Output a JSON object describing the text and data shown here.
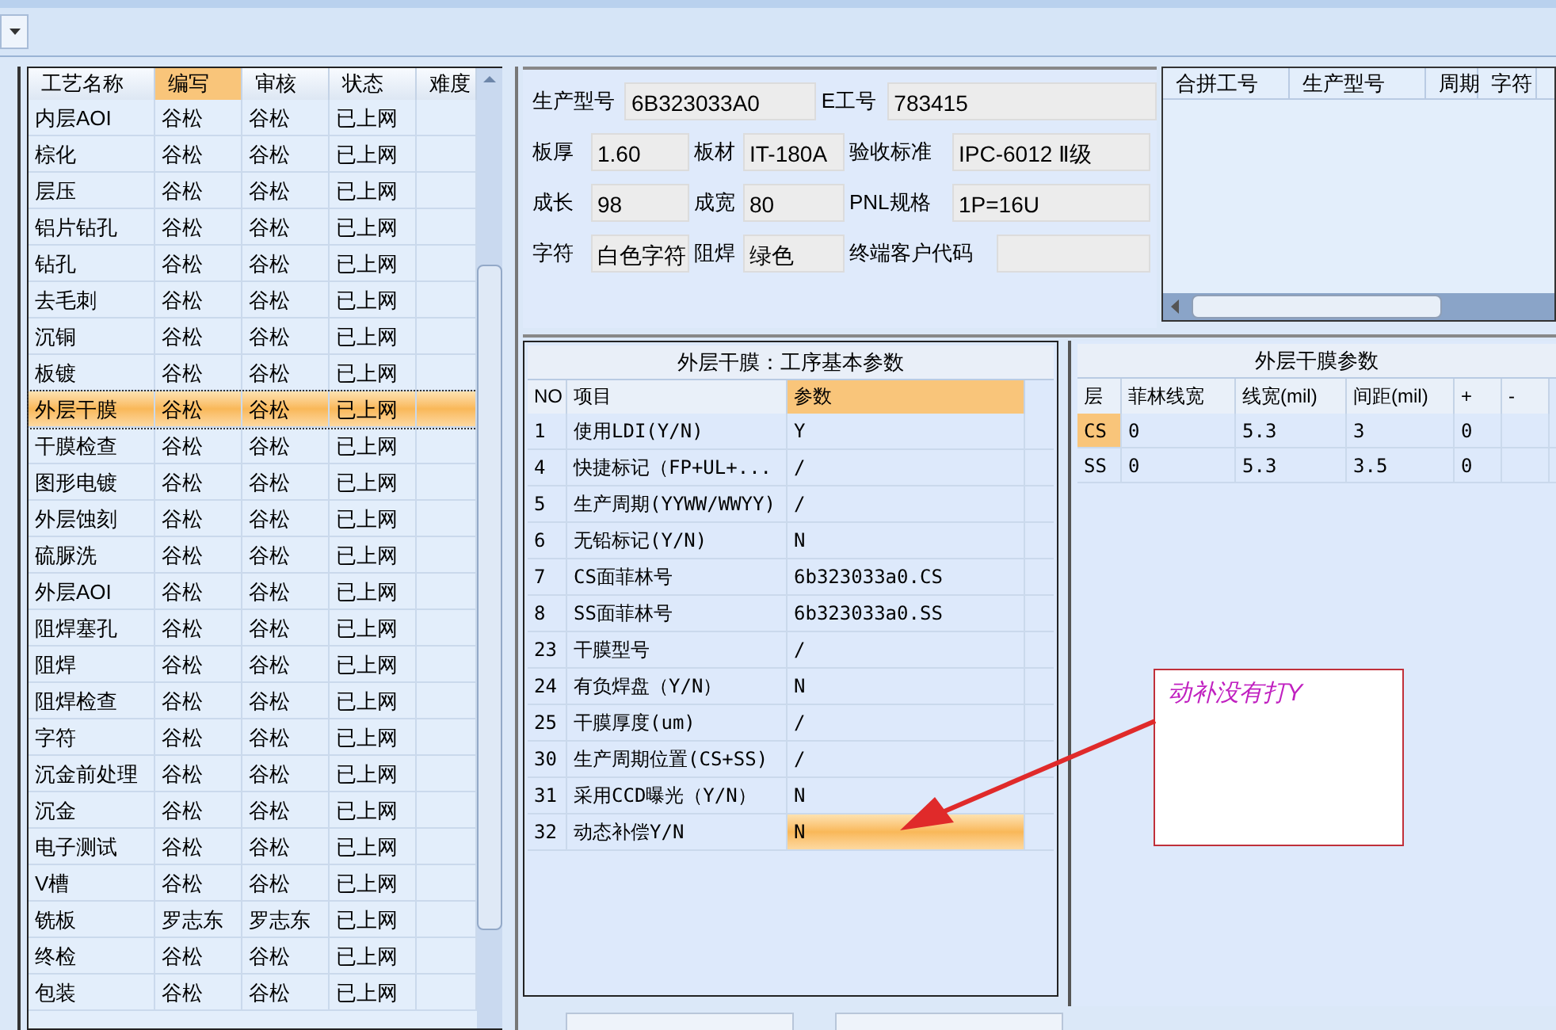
{
  "process_table": {
    "columns": [
      {
        "label": "工艺名称",
        "selected": false
      },
      {
        "label": "编写",
        "selected": true
      },
      {
        "label": "审核",
        "selected": false
      },
      {
        "label": "状态",
        "selected": false
      },
      {
        "label": "难度",
        "selected": false
      }
    ],
    "rows": [
      {
        "cells": [
          "内层AOI",
          "谷松",
          "谷松",
          "已上网",
          ""
        ],
        "selected": false
      },
      {
        "cells": [
          "棕化",
          "谷松",
          "谷松",
          "已上网",
          ""
        ],
        "selected": false
      },
      {
        "cells": [
          "层压",
          "谷松",
          "谷松",
          "已上网",
          ""
        ],
        "selected": false
      },
      {
        "cells": [
          "铝片钻孔",
          "谷松",
          "谷松",
          "已上网",
          ""
        ],
        "selected": false
      },
      {
        "cells": [
          "钻孔",
          "谷松",
          "谷松",
          "已上网",
          ""
        ],
        "selected": false
      },
      {
        "cells": [
          "去毛刺",
          "谷松",
          "谷松",
          "已上网",
          ""
        ],
        "selected": false
      },
      {
        "cells": [
          "沉铜",
          "谷松",
          "谷松",
          "已上网",
          ""
        ],
        "selected": false
      },
      {
        "cells": [
          "板镀",
          "谷松",
          "谷松",
          "已上网",
          ""
        ],
        "selected": false
      },
      {
        "cells": [
          "外层干膜",
          "谷松",
          "谷松",
          "已上网",
          ""
        ],
        "selected": true
      },
      {
        "cells": [
          "干膜检查",
          "谷松",
          "谷松",
          "已上网",
          ""
        ],
        "selected": false
      },
      {
        "cells": [
          "图形电镀",
          "谷松",
          "谷松",
          "已上网",
          ""
        ],
        "selected": false
      },
      {
        "cells": [
          "外层蚀刻",
          "谷松",
          "谷松",
          "已上网",
          ""
        ],
        "selected": false
      },
      {
        "cells": [
          "硫脲洗",
          "谷松",
          "谷松",
          "已上网",
          ""
        ],
        "selected": false
      },
      {
        "cells": [
          "外层AOI",
          "谷松",
          "谷松",
          "已上网",
          ""
        ],
        "selected": false
      },
      {
        "cells": [
          "阻焊塞孔",
          "谷松",
          "谷松",
          "已上网",
          ""
        ],
        "selected": false
      },
      {
        "cells": [
          "阻焊",
          "谷松",
          "谷松",
          "已上网",
          ""
        ],
        "selected": false
      },
      {
        "cells": [
          "阻焊检查",
          "谷松",
          "谷松",
          "已上网",
          ""
        ],
        "selected": false
      },
      {
        "cells": [
          "字符",
          "谷松",
          "谷松",
          "已上网",
          ""
        ],
        "selected": false
      },
      {
        "cells": [
          "沉金前处理",
          "谷松",
          "谷松",
          "已上网",
          ""
        ],
        "selected": false
      },
      {
        "cells": [
          "沉金",
          "谷松",
          "谷松",
          "已上网",
          ""
        ],
        "selected": false
      },
      {
        "cells": [
          "电子测试",
          "谷松",
          "谷松",
          "已上网",
          ""
        ],
        "selected": false
      },
      {
        "cells": [
          "V槽",
          "谷松",
          "谷松",
          "已上网",
          ""
        ],
        "selected": false
      },
      {
        "cells": [
          "铣板",
          "罗志东",
          "罗志东",
          "已上网",
          ""
        ],
        "selected": false
      },
      {
        "cells": [
          "终检",
          "谷松",
          "谷松",
          "已上网",
          ""
        ],
        "selected": false
      },
      {
        "cells": [
          "包装",
          "谷松",
          "谷松",
          "已上网",
          ""
        ],
        "selected": false
      }
    ]
  },
  "info_form": {
    "fields": [
      {
        "label": "生产型号",
        "value": "6B323033A0"
      },
      {
        "label": "E工号",
        "value": "783415"
      },
      {
        "label": "板厚",
        "value": "1.60"
      },
      {
        "label": "板材",
        "value": "IT-180A"
      },
      {
        "label": "验收标准",
        "value": "IPC-6012 Ⅱ级"
      },
      {
        "label": "成长",
        "value": "98"
      },
      {
        "label": "成宽",
        "value": "80"
      },
      {
        "label": "PNL规格",
        "value": "1P=16U"
      },
      {
        "label": "字符",
        "value": "白色字符"
      },
      {
        "label": "阻焊",
        "value": "绿色"
      },
      {
        "label": "终端客户代码"
      }
    ]
  },
  "merge_table": {
    "columns": [
      "合拼工号",
      "生产型号",
      "周期",
      "字符"
    ]
  },
  "basic_params": {
    "title": "外层干膜：工序基本参数",
    "columns": [
      {
        "label": "NO",
        "selected": false
      },
      {
        "label": "项目",
        "selected": false
      },
      {
        "label": "参数",
        "selected": true
      }
    ],
    "rows": [
      {
        "no": "1",
        "item": "使用LDI(Y/N)",
        "value": "Y",
        "selected": false
      },
      {
        "no": "4",
        "item": "快捷标记（FP+UL+...",
        "value": "/",
        "selected": false
      },
      {
        "no": "5",
        "item": "生产周期(YYWW/WWYY)",
        "value": "/",
        "selected": false
      },
      {
        "no": "6",
        "item": "无铅标记(Y/N)",
        "value": "N",
        "selected": false
      },
      {
        "no": "7",
        "item": "CS面菲林号",
        "value": "6b323033a0.CS",
        "selected": false
      },
      {
        "no": "8",
        "item": "SS面菲林号",
        "value": "6b323033a0.SS",
        "selected": false
      },
      {
        "no": "23",
        "item": "干膜型号",
        "value": "/",
        "selected": false
      },
      {
        "no": "24",
        "item": "有负焊盘（Y/N）",
        "value": "N",
        "selected": false
      },
      {
        "no": "25",
        "item": "干膜厚度(um)",
        "value": "/",
        "selected": false
      },
      {
        "no": "30",
        "item": "生产周期位置(CS+SS)",
        "value": "/",
        "selected": false
      },
      {
        "no": "31",
        "item": "采用CCD曝光（Y/N）",
        "value": "N",
        "selected": false
      },
      {
        "no": "32",
        "item": "动态补偿Y/N",
        "value": "N",
        "selected": true
      }
    ]
  },
  "film_params": {
    "title": "外层干膜参数",
    "columns": [
      "层",
      "菲林线宽",
      "线宽(mil)",
      "间距(mil)",
      "+",
      "-"
    ],
    "rows": [
      {
        "cells": [
          "CS",
          "0",
          "5.3",
          "3",
          "0"
        ],
        "selected": true
      },
      {
        "cells": [
          "SS",
          "0",
          "5.3",
          "3.5",
          "0"
        ],
        "selected": false
      }
    ]
  },
  "annotation": {
    "text": "动补没有打Y"
  }
}
